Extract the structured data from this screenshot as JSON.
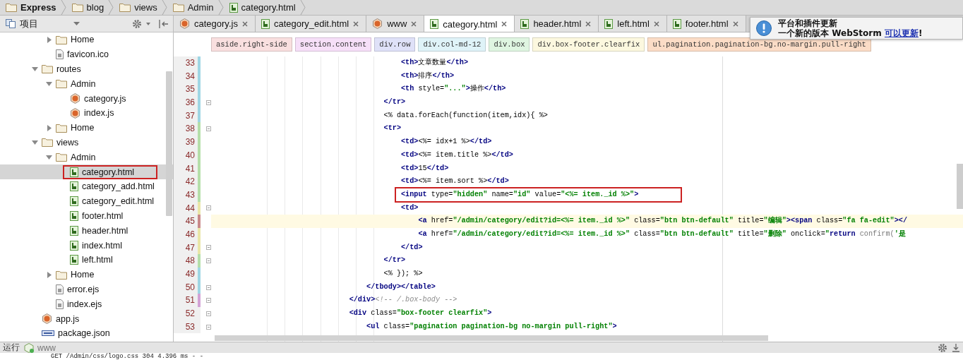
{
  "breadcrumb": [
    {
      "label": "Express",
      "kind": "folder"
    },
    {
      "label": "blog",
      "kind": "folder"
    },
    {
      "label": "views",
      "kind": "folder"
    },
    {
      "label": "Admin",
      "kind": "folder"
    },
    {
      "label": "category.html",
      "kind": "html"
    }
  ],
  "project_panel": {
    "title": "项目",
    "tree": [
      {
        "children": [
          {
            "label": "Home",
            "kind": "folder",
            "expanded": false,
            "selected": false,
            "annotated": false
          },
          {
            "label": "favicon.ico",
            "kind": "ico",
            "selected": false,
            "annotated": false
          }
        ]
      },
      {
        "label": "routes",
        "kind": "folder",
        "expanded": true,
        "selected": false,
        "annotated": false,
        "children": [
          {
            "label": "Admin",
            "kind": "folder",
            "expanded": true,
            "selected": false,
            "annotated": false,
            "children": [
              {
                "label": "category.js",
                "kind": "js",
                "selected": false,
                "annotated": false
              },
              {
                "label": "index.js",
                "kind": "js",
                "selected": false,
                "annotated": false
              }
            ]
          },
          {
            "label": "Home",
            "kind": "folder",
            "expanded": false,
            "selected": false,
            "annotated": false
          }
        ]
      },
      {
        "label": "views",
        "kind": "folder",
        "expanded": true,
        "selected": false,
        "annotated": false,
        "children": [
          {
            "label": "Admin",
            "kind": "folder",
            "expanded": true,
            "selected": false,
            "annotated": false,
            "children": [
              {
                "label": "category.html",
                "kind": "html",
                "selected": true,
                "annotated": true
              },
              {
                "label": "category_add.html",
                "kind": "html",
                "selected": false,
                "annotated": false
              },
              {
                "label": "category_edit.html",
                "kind": "html",
                "selected": false,
                "annotated": false
              },
              {
                "label": "footer.html",
                "kind": "html",
                "selected": false,
                "annotated": false
              },
              {
                "label": "header.html",
                "kind": "html",
                "selected": false,
                "annotated": false
              },
              {
                "label": "index.html",
                "kind": "html",
                "selected": false,
                "annotated": false
              },
              {
                "label": "left.html",
                "kind": "html",
                "selected": false,
                "annotated": false
              }
            ]
          },
          {
            "label": "Home",
            "kind": "folder",
            "expanded": false,
            "selected": false,
            "annotated": false
          },
          {
            "label": "error.ejs",
            "kind": "ejs",
            "selected": false,
            "annotated": false
          },
          {
            "label": "index.ejs",
            "kind": "ejs",
            "selected": false,
            "annotated": false
          }
        ]
      },
      {
        "label": "app.js",
        "kind": "js",
        "selected": false,
        "annotated": false
      },
      {
        "label": "package.json",
        "kind": "json",
        "selected": false,
        "annotated": false
      }
    ]
  },
  "tabs": [
    {
      "label": "category.js",
      "kind": "js",
      "selected": false
    },
    {
      "label": "category_edit.html",
      "kind": "html",
      "selected": false
    },
    {
      "label": "www",
      "kind": "js",
      "selected": false
    },
    {
      "label": "category.html",
      "kind": "html",
      "selected": true
    },
    {
      "label": "header.html",
      "kind": "html",
      "selected": false
    },
    {
      "label": "left.html",
      "kind": "html",
      "selected": false
    },
    {
      "label": "footer.html",
      "kind": "html",
      "selected": false
    }
  ],
  "tag_path": [
    {
      "label": "aside.right-side",
      "color": "#f9dfdf"
    },
    {
      "label": "section.content",
      "color": "#f6dff8"
    },
    {
      "label": "div.row",
      "color": "#dfe1f8"
    },
    {
      "label": "div.col-md-12",
      "color": "#dff3f8"
    },
    {
      "label": "div.box",
      "color": "#dff5e1"
    },
    {
      "label": "div.box-footer.clearfix",
      "color": "#fcf8df"
    },
    {
      "label": "ul.pagination.pagination-bg.no-margin.pull-right",
      "color": "#fbdcc6"
    }
  ],
  "code_lines": [
    {
      "number": "33",
      "fold": false,
      "current": false,
      "annotated": false,
      "color": "#9fd6e4",
      "tokens": [
        {
          "kind": "tag",
          "text": "                                            <th>"
        },
        {
          "kind": "text",
          "text": "文章数量"
        },
        {
          "kind": "tag",
          "text": "</th>"
        }
      ]
    },
    {
      "number": "34",
      "fold": false,
      "current": false,
      "annotated": false,
      "color": "#9fd6e4",
      "tokens": [
        {
          "kind": "tag",
          "text": "                                            <th>"
        },
        {
          "kind": "text",
          "text": "排序"
        },
        {
          "kind": "tag",
          "text": "</th>"
        }
      ]
    },
    {
      "number": "35",
      "fold": false,
      "current": false,
      "annotated": false,
      "color": "#9fd6e4",
      "tokens": [
        {
          "kind": "tag",
          "text": "                                            <th"
        },
        {
          "kind": "attr",
          "text": " style="
        },
        {
          "kind": "value",
          "text": "\"...\""
        },
        {
          "kind": "tag",
          "text": ">"
        },
        {
          "kind": "text",
          "text": "操作"
        },
        {
          "kind": "tag",
          "text": "</th>"
        }
      ]
    },
    {
      "number": "36",
      "fold": true,
      "current": false,
      "annotated": false,
      "color": "#9fd6e4",
      "tokens": [
        {
          "kind": "tag",
          "text": "                                        </tr>"
        }
      ]
    },
    {
      "number": "37",
      "fold": false,
      "current": false,
      "annotated": false,
      "color": "#9fd6e4",
      "tokens": [
        {
          "kind": "text",
          "text": "                                        <% data.forEach(function(item,idx){ %>"
        }
      ]
    },
    {
      "number": "38",
      "fold": true,
      "current": false,
      "annotated": false,
      "color": "#b5dfa9",
      "tokens": [
        {
          "kind": "tag",
          "text": "                                        <tr>"
        }
      ]
    },
    {
      "number": "39",
      "fold": false,
      "current": false,
      "annotated": false,
      "color": "#b5dfa9",
      "tokens": [
        {
          "kind": "tag",
          "text": "                                            <td>"
        },
        {
          "kind": "text",
          "text": "<%= idx+1 %>"
        },
        {
          "kind": "tag",
          "text": "</td>"
        }
      ]
    },
    {
      "number": "40",
      "fold": false,
      "current": false,
      "annotated": false,
      "color": "#b5dfa9",
      "tokens": [
        {
          "kind": "tag",
          "text": "                                            <td>"
        },
        {
          "kind": "text",
          "text": "<%= item.title %>"
        },
        {
          "kind": "tag",
          "text": "</td>"
        }
      ]
    },
    {
      "number": "41",
      "fold": false,
      "current": false,
      "annotated": false,
      "color": "#b5dfa9",
      "tokens": [
        {
          "kind": "tag",
          "text": "                                            <td>"
        },
        {
          "kind": "text",
          "text": "15"
        },
        {
          "kind": "tag",
          "text": "</td>"
        }
      ]
    },
    {
      "number": "42",
      "fold": false,
      "current": false,
      "annotated": false,
      "color": "#b5dfa9",
      "tokens": [
        {
          "kind": "tag",
          "text": "                                            <td>"
        },
        {
          "kind": "text",
          "text": "<%= item.sort %>"
        },
        {
          "kind": "tag",
          "text": "</td>"
        }
      ]
    },
    {
      "number": "43",
      "fold": false,
      "current": false,
      "annotated": true,
      "color": "#b5dfa9",
      "tokens": [
        {
          "kind": "tag",
          "text": "                                            <input"
        },
        {
          "kind": "attr",
          "text": " type="
        },
        {
          "kind": "value",
          "text": "\"hidden\""
        },
        {
          "kind": "attr",
          "text": " name="
        },
        {
          "kind": "value",
          "text": "\"id\""
        },
        {
          "kind": "attr",
          "text": " value="
        },
        {
          "kind": "value",
          "text": "\"<%= item._id %>\""
        },
        {
          "kind": "tag",
          "text": ">"
        }
      ]
    },
    {
      "number": "44",
      "fold": true,
      "current": false,
      "annotated": false,
      "color": "#e9e6a8",
      "tokens": [
        {
          "kind": "tag",
          "text": "                                            <td>"
        }
      ]
    },
    {
      "number": "45",
      "fold": false,
      "current": true,
      "annotated": false,
      "color": "#c98a8a",
      "tokens": [
        {
          "kind": "tag",
          "text": "                                                <a"
        },
        {
          "kind": "attr",
          "text": " href="
        },
        {
          "kind": "value",
          "text": "\"/admin/category/edit?id=<%= item._id %>\""
        },
        {
          "kind": "attr",
          "text": " class="
        },
        {
          "kind": "value",
          "text": "\"btn btn-default\""
        },
        {
          "kind": "attr",
          "text": " title="
        },
        {
          "kind": "value",
          "text": "\"编辑\""
        },
        {
          "kind": "tag",
          "text": "><span"
        },
        {
          "kind": "attr",
          "text": " class="
        },
        {
          "kind": "value",
          "text": "\"fa fa-edit\""
        },
        {
          "kind": "tag",
          "text": "></"
        }
      ]
    },
    {
      "number": "46",
      "fold": false,
      "current": false,
      "annotated": false,
      "color": "#e9e6a8",
      "tokens": [
        {
          "kind": "tag",
          "text": "                                                <a"
        },
        {
          "kind": "attr",
          "text": " href="
        },
        {
          "kind": "value",
          "text": "\"/admin/category/edit?id=<%= item._id %>\""
        },
        {
          "kind": "attr",
          "text": " class="
        },
        {
          "kind": "value",
          "text": "\"btn btn-default\""
        },
        {
          "kind": "attr",
          "text": " title="
        },
        {
          "kind": "value",
          "text": "\"删除\""
        },
        {
          "kind": "attr",
          "text": " onclick="
        },
        {
          "kind": "value",
          "text": "\""
        },
        {
          "kind": "keyword",
          "text": "return"
        },
        {
          "kind": "js",
          "text": " confirm("
        },
        {
          "kind": "value",
          "text": "'是"
        }
      ]
    },
    {
      "number": "47",
      "fold": true,
      "current": false,
      "annotated": false,
      "color": "#e9e6a8",
      "tokens": [
        {
          "kind": "tag",
          "text": "                                            </td>"
        }
      ]
    },
    {
      "number": "48",
      "fold": true,
      "current": false,
      "annotated": false,
      "color": "#b5dfa9",
      "tokens": [
        {
          "kind": "tag",
          "text": "                                        </tr>"
        }
      ]
    },
    {
      "number": "49",
      "fold": false,
      "current": false,
      "annotated": false,
      "color": "#9fd6e4",
      "tokens": [
        {
          "kind": "text",
          "text": "                                        <% }); %>"
        }
      ]
    },
    {
      "number": "50",
      "fold": true,
      "current": false,
      "annotated": false,
      "color": "#9fd6e4",
      "tokens": [
        {
          "kind": "tag",
          "text": "                                    </tbody></table>"
        }
      ]
    },
    {
      "number": "51",
      "fold": true,
      "current": false,
      "annotated": false,
      "color": "#d2a3d6",
      "tokens": [
        {
          "kind": "tag",
          "text": "                                </div>"
        },
        {
          "kind": "comment",
          "text": "<!-- /.box-body -->"
        }
      ]
    },
    {
      "number": "52",
      "fold": true,
      "current": false,
      "annotated": false,
      "tokens": [
        {
          "kind": "tag",
          "text": "                                <div"
        },
        {
          "kind": "attr",
          "text": " class="
        },
        {
          "kind": "value",
          "text": "\"box-footer clearfix\""
        },
        {
          "kind": "tag",
          "text": ">"
        }
      ]
    },
    {
      "number": "53",
      "fold": true,
      "current": false,
      "annotated": false,
      "tokens": [
        {
          "kind": "tag",
          "text": "                                    <ul"
        },
        {
          "kind": "attr",
          "text": " class="
        },
        {
          "kind": "value",
          "text": "\"pagination pagination-bg no-margin pull-right\""
        },
        {
          "kind": "tag",
          "text": ">"
        }
      ]
    }
  ],
  "notification": {
    "title": "平台和插件更新",
    "message": "一个新的版本 WebStorm ",
    "link": "可以更新",
    "message_end": "!"
  },
  "run_bar": {
    "label": "运行",
    "configuration": "www"
  },
  "console_lines": [
    "GET /Admin/css/logo.css 304 4.396 ms - -"
  ]
}
